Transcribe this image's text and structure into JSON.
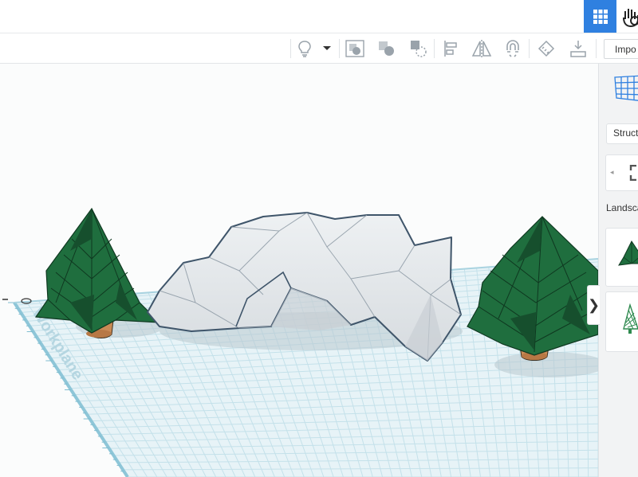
{
  "colors": {
    "accent": "#2f80e0",
    "grid_line": "#b9dce6",
    "grid_bg": "#e7f3f7",
    "ruler": "#8ec6d8",
    "tree_green": "#1f6e3e",
    "tree_dark": "#164f2d",
    "trunk": "#c98a55",
    "rock": "#dfe3e6",
    "rock_edge": "#3f556a"
  },
  "topbar": {
    "grid_view_icon": "grid-icon",
    "sim_icon": "hand-sim-icon"
  },
  "toolbar": {
    "tools": [
      {
        "name": "lightbulb-icon"
      },
      {
        "name": "dropdown-caret-icon"
      },
      {
        "name": "group-icon"
      },
      {
        "name": "ungroup-icon"
      },
      {
        "name": "align-icon"
      },
      {
        "name": "mirror-icon"
      },
      {
        "name": "magnet-icon"
      },
      {
        "name": "cruise-icon"
      },
      {
        "name": "ruler-icon"
      },
      {
        "name": "workplane-icon"
      }
    ],
    "import_label": "Impo"
  },
  "workplane": {
    "label": "Workplane"
  },
  "side_panel": {
    "toggle_glyph": "❯",
    "category_label": "Structu",
    "library_title": "Landsca",
    "library_items": [
      {
        "name": "pine-tree-shape"
      },
      {
        "name": "lattice-tree-shape"
      }
    ]
  }
}
